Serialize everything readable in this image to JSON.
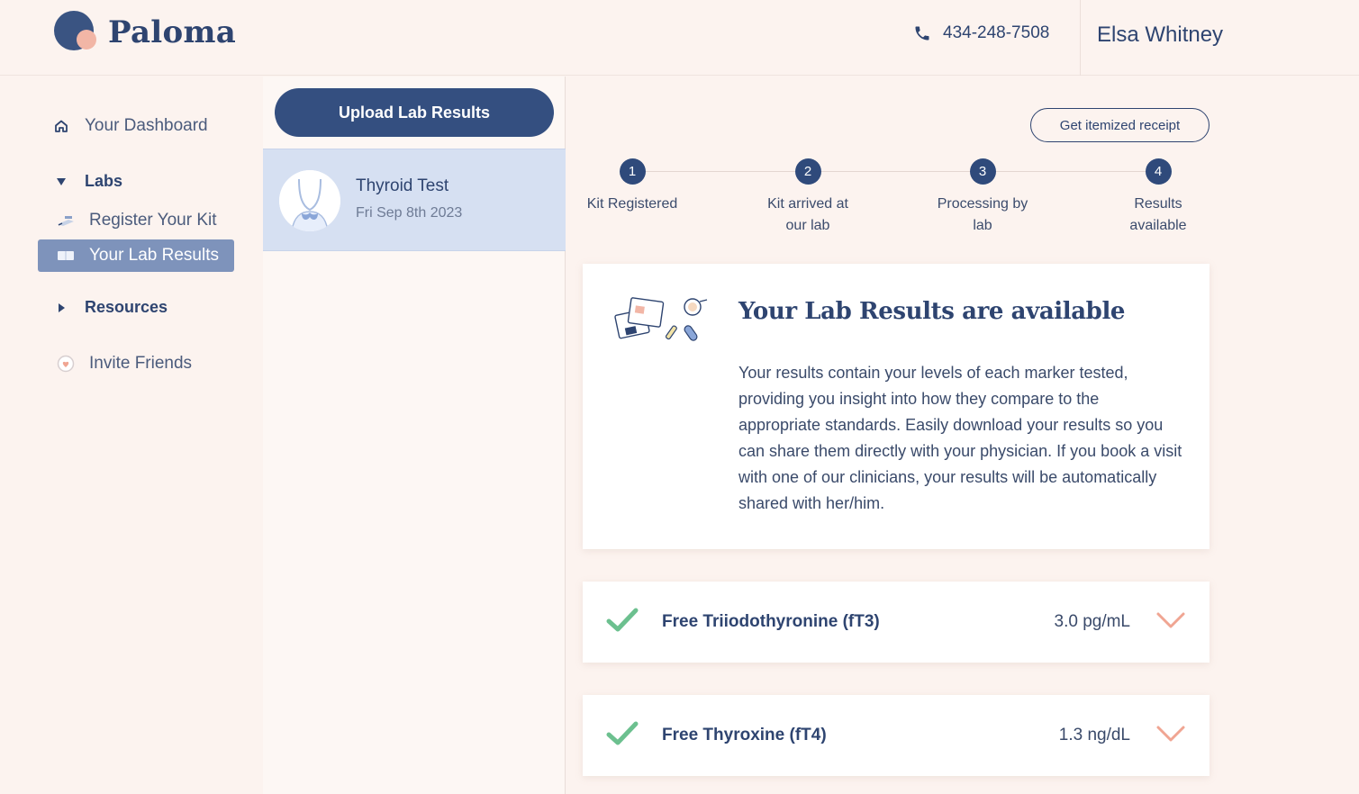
{
  "header": {
    "brand": "Paloma",
    "phone": "434-248-7508",
    "user_name": "Elsa Whitney"
  },
  "sidebar": {
    "items": [
      {
        "label": "Your Dashboard",
        "icon": "home-icon"
      },
      {
        "label": "Labs",
        "icon": "triangle-down-icon"
      },
      {
        "label": "Register Your Kit",
        "icon": "kit-icon"
      },
      {
        "label": "Your Lab Results",
        "icon": "book-icon",
        "active": true
      },
      {
        "label": "Resources",
        "icon": "triangle-right-icon"
      },
      {
        "label": "Invite Friends",
        "icon": "heart-badge-icon"
      }
    ]
  },
  "middle": {
    "upload_label": "Upload Lab Results",
    "tests": [
      {
        "title": "Thyroid Test",
        "date": "Fri Sep 8th 2023"
      }
    ]
  },
  "main": {
    "receipt_label": "Get itemized receipt",
    "steps": [
      {
        "num": "1",
        "line1": "Kit Registered",
        "line2": ""
      },
      {
        "num": "2",
        "line1": "Kit arrived at",
        "line2": "our lab"
      },
      {
        "num": "3",
        "line1": "Processing by",
        "line2": "lab"
      },
      {
        "num": "4",
        "line1": "Results",
        "line2": "available"
      }
    ],
    "info": {
      "title": "Your Lab Results are available",
      "body": "Your results contain your levels of each marker tested, providing you insight into how they compare to the appropriate standards. Easily download your results so you can share them directly with your physician. If you book a visit with one of our clinicians, your results will be automatically shared with her/him."
    },
    "markers": [
      {
        "name": "Free Triiodothyronine (fT3)",
        "value": "3.0 pg/mL"
      },
      {
        "name": "Free Thyroxine (fT4)",
        "value": "1.3 ng/dL"
      }
    ]
  },
  "colors": {
    "background": "#fcf3ef",
    "navy": "#2e4470",
    "active_nav": "#7e93bb",
    "selected_card": "#d6e0f2",
    "check_green": "#6cc08f",
    "chevron_coral": "#f0a592"
  }
}
